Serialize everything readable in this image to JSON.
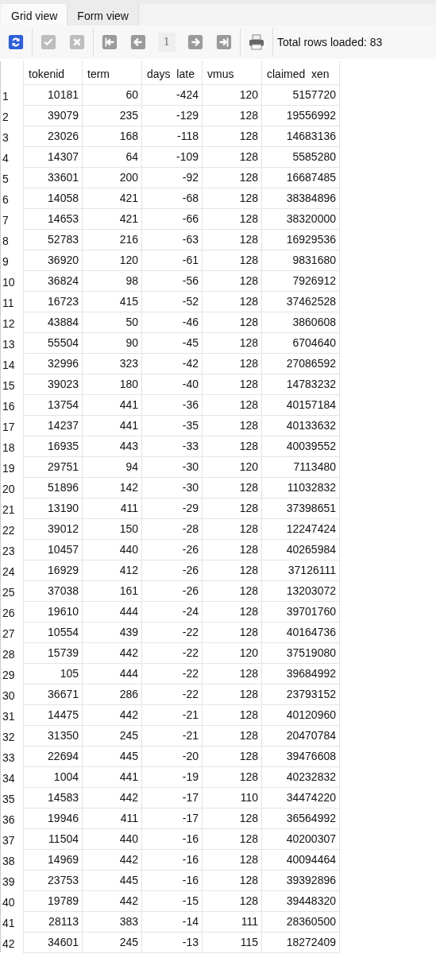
{
  "tabs": [
    {
      "label": "Grid view",
      "selected": true
    },
    {
      "label": "Form view",
      "selected": false
    }
  ],
  "toolbar": {
    "buttons": [
      {
        "kind": "refresh",
        "disabled": false
      },
      {
        "kind": "commit",
        "disabled": true
      },
      {
        "kind": "rollback",
        "disabled": true
      },
      {
        "kind": "first",
        "disabled": false
      },
      {
        "kind": "previous",
        "disabled": false
      },
      {
        "kind": "page",
        "label": "1"
      },
      {
        "kind": "next",
        "disabled": false
      },
      {
        "kind": "last",
        "disabled": false
      },
      {
        "kind": "print",
        "disabled": false
      }
    ],
    "status": "Total rows loaded: 83"
  },
  "table": {
    "columns": [
      "tokenid",
      "term",
      "days  late",
      "vmus",
      "claimed  xen"
    ],
    "rows": [
      {
        "row_number": "1",
        "cells": [
          "10181",
          "60",
          "-424",
          "120",
          "5157720"
        ]
      },
      {
        "row_number": "2",
        "cells": [
          "39079",
          "235",
          "-129",
          "128",
          "19556992"
        ]
      },
      {
        "row_number": "3",
        "cells": [
          "23026",
          "168",
          "-118",
          "128",
          "14683136"
        ]
      },
      {
        "row_number": "4",
        "cells": [
          "14307",
          "64",
          "-109",
          "128",
          "5585280"
        ]
      },
      {
        "row_number": "5",
        "cells": [
          "33601",
          "200",
          "-92",
          "128",
          "16687485"
        ]
      },
      {
        "row_number": "6",
        "cells": [
          "14058",
          "421",
          "-68",
          "128",
          "38384896"
        ]
      },
      {
        "row_number": "7",
        "cells": [
          "14653",
          "421",
          "-66",
          "128",
          "38320000"
        ]
      },
      {
        "row_number": "8",
        "cells": [
          "52783",
          "216",
          "-63",
          "128",
          "16929536"
        ]
      },
      {
        "row_number": "9",
        "cells": [
          "36920",
          "120",
          "-61",
          "128",
          "9831680"
        ]
      },
      {
        "row_number": "10",
        "cells": [
          "36824",
          "98",
          "-56",
          "128",
          "7926912"
        ]
      },
      {
        "row_number": "11",
        "cells": [
          "16723",
          "415",
          "-52",
          "128",
          "37462528"
        ]
      },
      {
        "row_number": "12",
        "cells": [
          "43884",
          "50",
          "-46",
          "128",
          "3860608"
        ]
      },
      {
        "row_number": "13",
        "cells": [
          "55504",
          "90",
          "-45",
          "128",
          "6704640"
        ]
      },
      {
        "row_number": "14",
        "cells": [
          "32996",
          "323",
          "-42",
          "128",
          "27086592"
        ]
      },
      {
        "row_number": "15",
        "cells": [
          "39023",
          "180",
          "-40",
          "128",
          "14783232"
        ]
      },
      {
        "row_number": "16",
        "cells": [
          "13754",
          "441",
          "-36",
          "128",
          "40157184"
        ]
      },
      {
        "row_number": "17",
        "cells": [
          "14237",
          "441",
          "-35",
          "128",
          "40133632"
        ]
      },
      {
        "row_number": "18",
        "cells": [
          "16935",
          "443",
          "-33",
          "128",
          "40039552"
        ]
      },
      {
        "row_number": "19",
        "cells": [
          "29751",
          "94",
          "-30",
          "120",
          "7113480"
        ]
      },
      {
        "row_number": "20",
        "cells": [
          "51896",
          "142",
          "-30",
          "128",
          "11032832"
        ]
      },
      {
        "row_number": "21",
        "cells": [
          "13190",
          "411",
          "-29",
          "128",
          "37398651"
        ]
      },
      {
        "row_number": "22",
        "cells": [
          "39012",
          "150",
          "-28",
          "128",
          "12247424"
        ]
      },
      {
        "row_number": "23",
        "cells": [
          "10457",
          "440",
          "-26",
          "128",
          "40265984"
        ]
      },
      {
        "row_number": "24",
        "cells": [
          "16929",
          "412",
          "-26",
          "128",
          "37126111"
        ]
      },
      {
        "row_number": "25",
        "cells": [
          "37038",
          "161",
          "-26",
          "128",
          "13203072"
        ]
      },
      {
        "row_number": "26",
        "cells": [
          "19610",
          "444",
          "-24",
          "128",
          "39701760"
        ]
      },
      {
        "row_number": "27",
        "cells": [
          "10554",
          "439",
          "-22",
          "128",
          "40164736"
        ]
      },
      {
        "row_number": "28",
        "cells": [
          "15739",
          "442",
          "-22",
          "120",
          "37519080"
        ]
      },
      {
        "row_number": "29",
        "cells": [
          "105",
          "444",
          "-22",
          "128",
          "39684992"
        ]
      },
      {
        "row_number": "30",
        "cells": [
          "36671",
          "286",
          "-22",
          "128",
          "23793152"
        ]
      },
      {
        "row_number": "31",
        "cells": [
          "14475",
          "442",
          "-21",
          "128",
          "40120960"
        ]
      },
      {
        "row_number": "32",
        "cells": [
          "31350",
          "245",
          "-21",
          "128",
          "20470784"
        ]
      },
      {
        "row_number": "33",
        "cells": [
          "22694",
          "445",
          "-20",
          "128",
          "39476608"
        ]
      },
      {
        "row_number": "34",
        "cells": [
          "1004",
          "441",
          "-19",
          "128",
          "40232832"
        ]
      },
      {
        "row_number": "35",
        "cells": [
          "14583",
          "442",
          "-17",
          "110",
          "34474220"
        ]
      },
      {
        "row_number": "36",
        "cells": [
          "19946",
          "411",
          "-17",
          "128",
          "36564992"
        ]
      },
      {
        "row_number": "37",
        "cells": [
          "11504",
          "440",
          "-16",
          "128",
          "40200307"
        ]
      },
      {
        "row_number": "38",
        "cells": [
          "14969",
          "442",
          "-16",
          "128",
          "40094464"
        ]
      },
      {
        "row_number": "39",
        "cells": [
          "23753",
          "445",
          "-16",
          "128",
          "39392896"
        ]
      },
      {
        "row_number": "40",
        "cells": [
          "19789",
          "442",
          "-15",
          "128",
          "39448320"
        ]
      },
      {
        "row_number": "41",
        "cells": [
          "28113",
          "383",
          "-14",
          "111",
          "28360500"
        ]
      },
      {
        "row_number": "42",
        "cells": [
          "34601",
          "245",
          "-13",
          "115",
          "18272409"
        ]
      }
    ]
  }
}
